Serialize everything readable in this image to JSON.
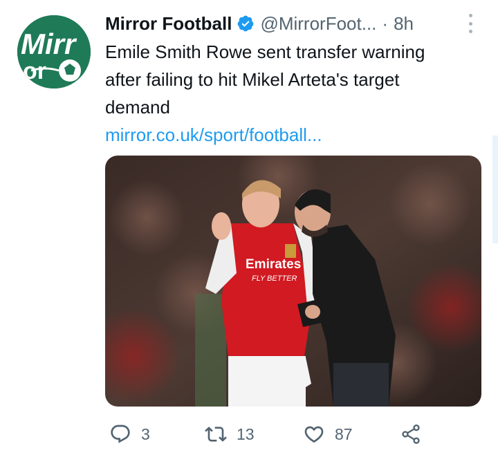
{
  "tweet": {
    "author_name": "Mirror Football",
    "handle": "@MirrorFoot...",
    "separator": "·",
    "time": "8h",
    "avatar_label": "Mirr or",
    "text_lines": [
      "Emile Smith Rowe sent transfer warning",
      "after failing to hit Mikel Arteta's target",
      "demand"
    ],
    "link": "mirror.co.uk/sport/football...",
    "image_shirt_text": [
      "Emirates",
      "FLY BETTER"
    ]
  },
  "actions": {
    "replies": "3",
    "retweets": "13",
    "likes": "87"
  },
  "colors": {
    "brand_green": "#1f7a57",
    "verified_blue": "#1d9bf0",
    "link_blue": "#1d9bf0",
    "text": "#0f1419",
    "muted": "#536471"
  }
}
